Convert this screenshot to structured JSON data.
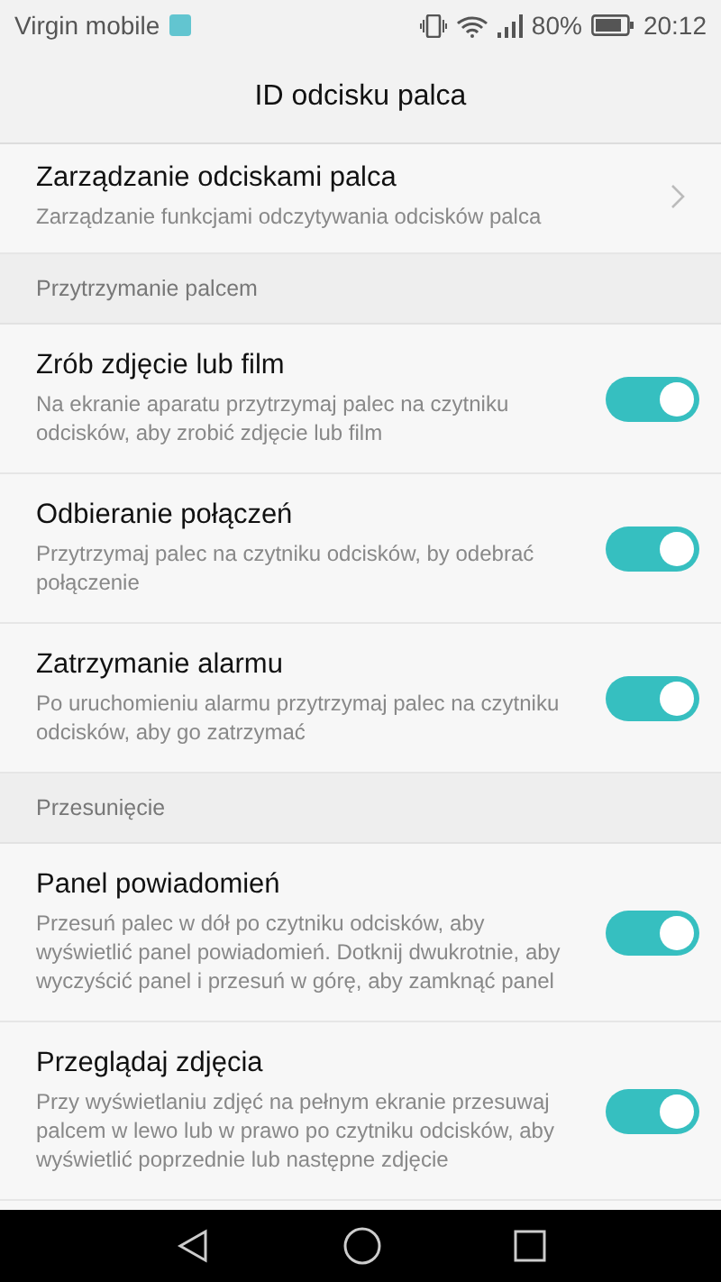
{
  "status_bar": {
    "carrier": "Virgin mobile",
    "battery": "80%",
    "time": "20:12"
  },
  "title": "ID odcisku palca",
  "items": [
    {
      "kind": "link",
      "title": "Zarządzanie odciskami palca",
      "description": "Zarządzanie funkcjami odczytywania odcisków palca"
    },
    {
      "kind": "section",
      "title": "Przytrzymanie palcem"
    },
    {
      "kind": "toggle",
      "title": "Zrób zdjęcie lub film",
      "description": "Na ekranie aparatu przytrzymaj palec na czytniku odcisków, aby zrobić zdjęcie lub film",
      "on": true
    },
    {
      "kind": "toggle",
      "title": "Odbieranie połączeń",
      "description": "Przytrzymaj palec na czytniku odcisków, by odebrać połączenie",
      "on": true
    },
    {
      "kind": "toggle",
      "title": "Zatrzymanie alarmu",
      "description": "Po uruchomieniu alarmu przytrzymaj palec na czytniku odcisków, aby go zatrzymać",
      "on": true
    },
    {
      "kind": "section",
      "title": "Przesunięcie"
    },
    {
      "kind": "toggle",
      "title": "Panel powiadomień",
      "description": "Przesuń palec w dół po czytniku odcisków, aby wyświetlić panel powiadomień. Dotknij dwukrotnie, aby wyczyścić panel i przesuń w górę, aby zamknąć panel",
      "on": true
    },
    {
      "kind": "toggle",
      "title": "Przeglądaj zdjęcia",
      "description": "Przy wyświetlaniu zdjęć na pełnym ekranie przesuwaj palcem w lewo lub w prawo po czytniku odcisków, aby wyświetlić poprzednie lub następne zdjęcie",
      "on": true
    }
  ]
}
